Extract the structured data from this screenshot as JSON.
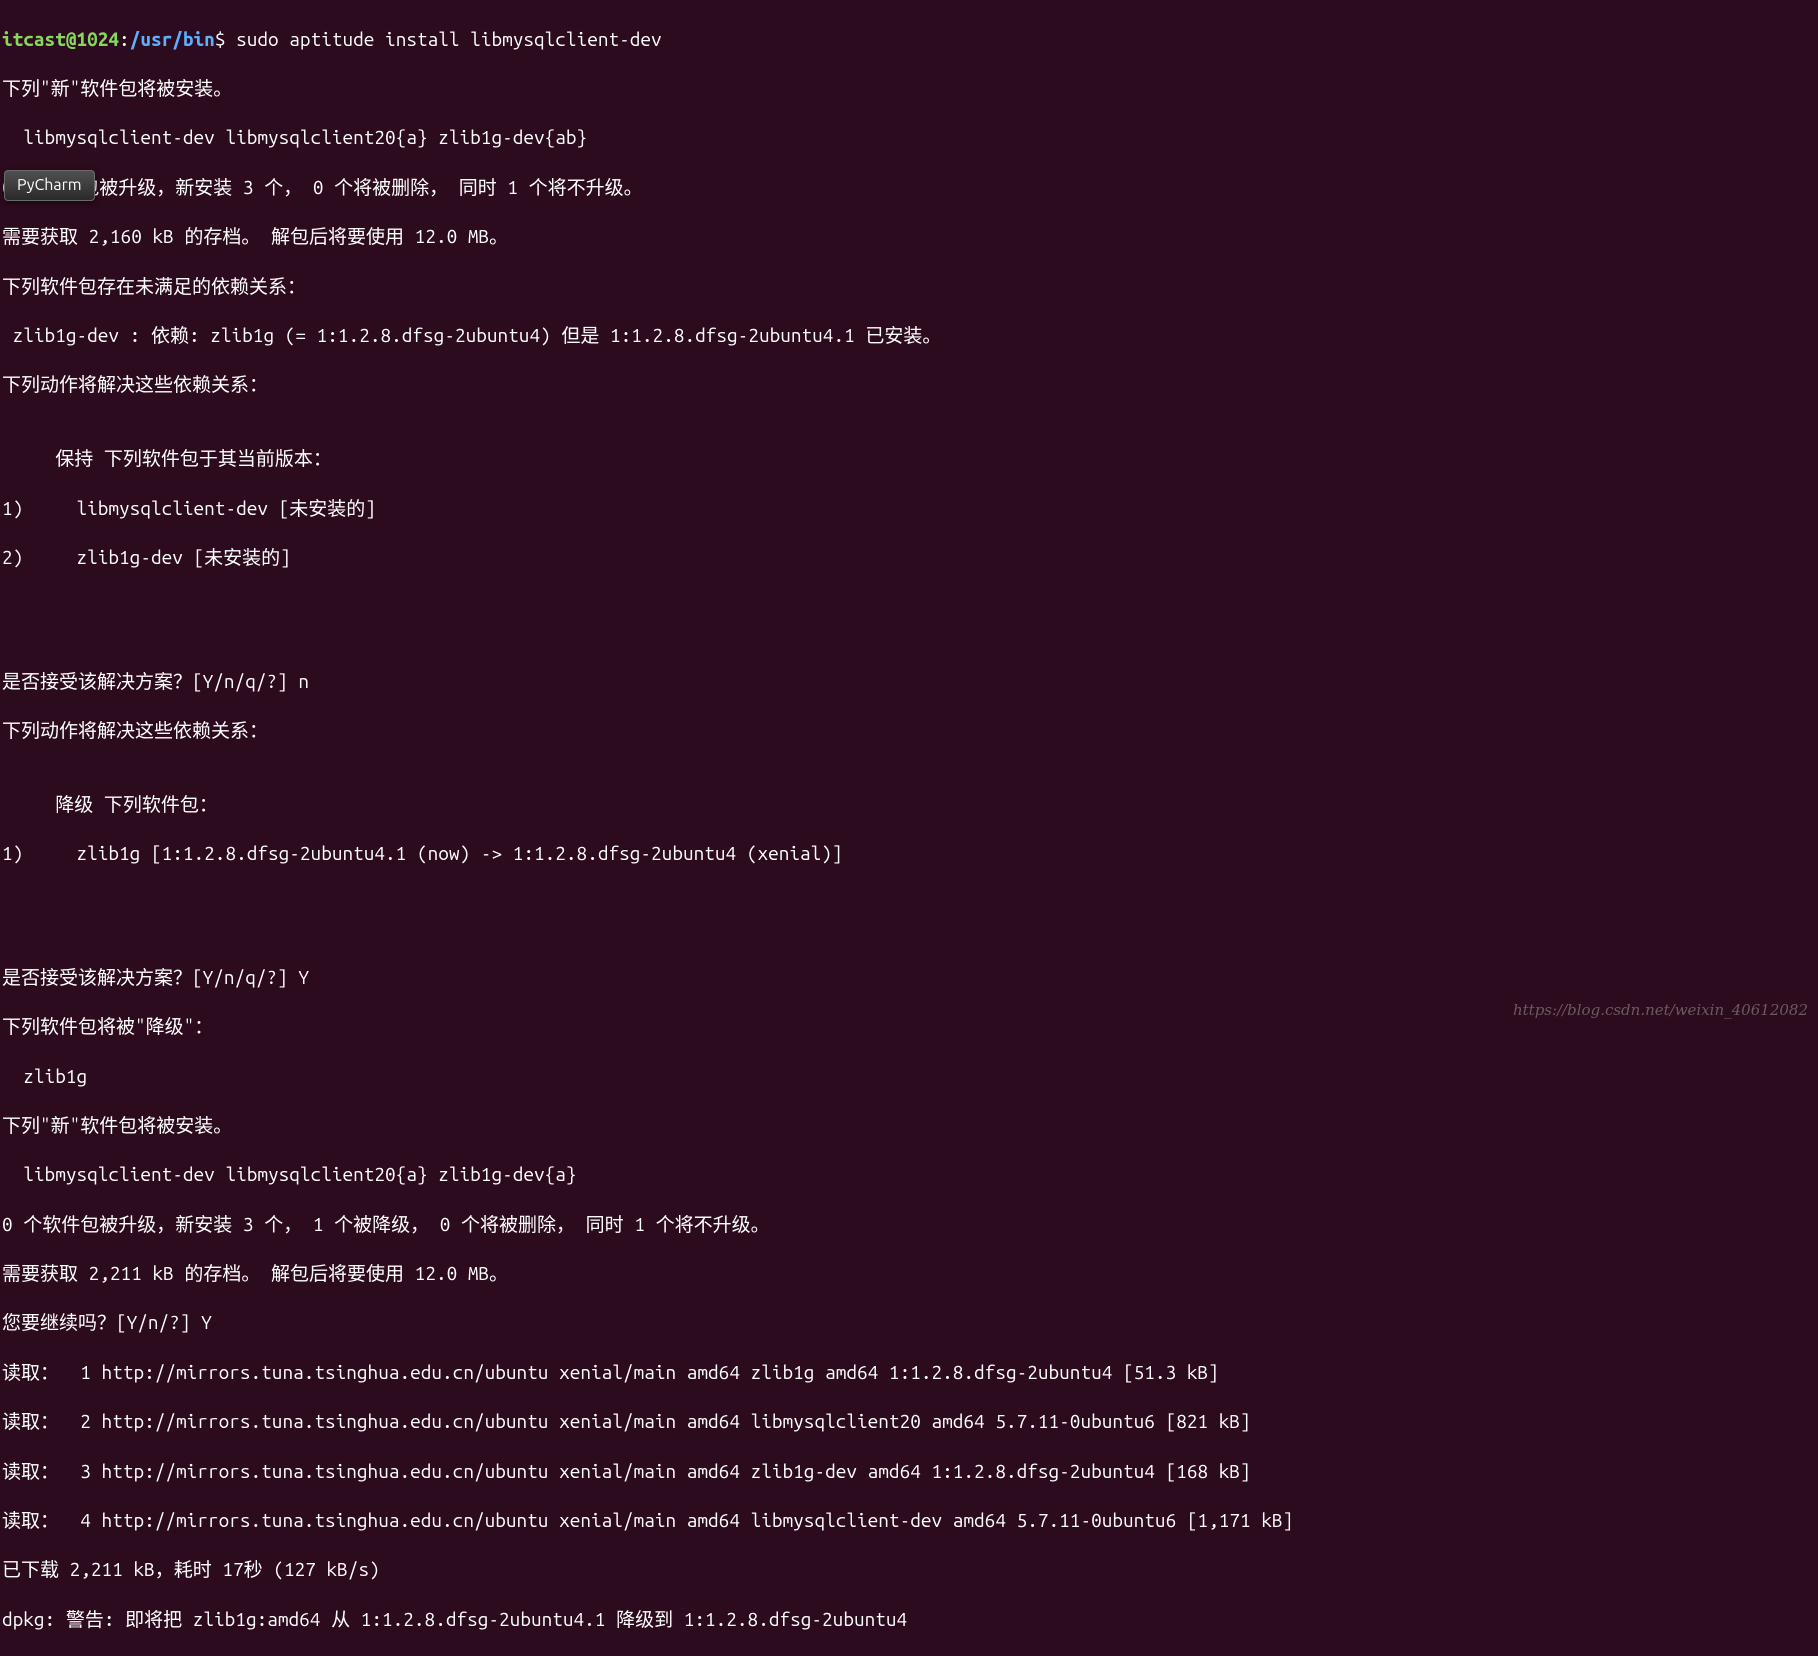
{
  "prompt": {
    "user_host": "itcast@1024",
    "separator": ":",
    "path": "/usr/bin",
    "dollar": "$",
    "command": " sudo aptitude install libmysqlclient-dev"
  },
  "tooltip": {
    "label": "PyCharm"
  },
  "watermark": {
    "text": "https://blog.csdn.net/weixin_40612082"
  },
  "lines": [
    "下列\"新\"软件包将被安装。",
    "  libmysqlclient-dev libmysqlclient20{a} zlib1g-dev{ab} ",
    "0 个软件包被升级，新安装 3 个， 0 个将被删除， 同时 1 个将不升级。",
    "需要获取 2,160 kB 的存档。 解包后将要使用 12.0 MB。",
    "下列软件包存在未满足的依赖关系：",
    " zlib1g-dev : 依赖: zlib1g (= 1:1.2.8.dfsg-2ubuntu4) 但是 1:1.2.8.dfsg-2ubuntu4.1 已安装。",
    "下列动作将解决这些依赖关系：",
    "",
    "     保持 下列软件包于其当前版本：",
    "1)     libmysqlclient-dev [未安装的]",
    "2)     zlib1g-dev [未安装的]    ",
    "",
    "",
    "",
    "是否接受该解决方案？[Y/n/q/?] n",
    "下列动作将解决这些依赖关系：",
    "",
    "     降级 下列软件包：               ",
    "1)     zlib1g [1:1.2.8.dfsg-2ubuntu4.1 (now) -> 1:1.2.8.dfsg-2ubuntu4 (xenial)]",
    "",
    "",
    "",
    "是否接受该解决方案？[Y/n/q/?] Y",
    "下列软件包将被\"降级\"：",
    "  zlib1g ",
    "下列\"新\"软件包将被安装。",
    "  libmysqlclient-dev libmysqlclient20{a} zlib1g-dev{a} ",
    "0 个软件包被升级，新安装 3 个， 1 个被降级， 0 个将被删除， 同时 1 个将不升级。",
    "需要获取 2,211 kB 的存档。 解包后将要使用 12.0 MB。",
    "您要继续吗？[Y/n/?] Y",
    "读取：  1 http://mirrors.tuna.tsinghua.edu.cn/ubuntu xenial/main amd64 zlib1g amd64 1:1.2.8.dfsg-2ubuntu4 [51.3 kB]",
    "读取：  2 http://mirrors.tuna.tsinghua.edu.cn/ubuntu xenial/main amd64 libmysqlclient20 amd64 5.7.11-0ubuntu6 [821 kB]",
    "读取：  3 http://mirrors.tuna.tsinghua.edu.cn/ubuntu xenial/main amd64 zlib1g-dev amd64 1:1.2.8.dfsg-2ubuntu4 [168 kB]",
    "读取：  4 http://mirrors.tuna.tsinghua.edu.cn/ubuntu xenial/main amd64 libmysqlclient-dev amd64 5.7.11-0ubuntu6 [1,171 kB]",
    "已下载 2,211 kB，耗时 17秒 (127 kB/s)",
    "dpkg: 警告: 即将把 zlib1g:amd64 从 1:1.2.8.dfsg-2ubuntu4.1 降级到 1:1.2.8.dfsg-2ubuntu4"
  ]
}
